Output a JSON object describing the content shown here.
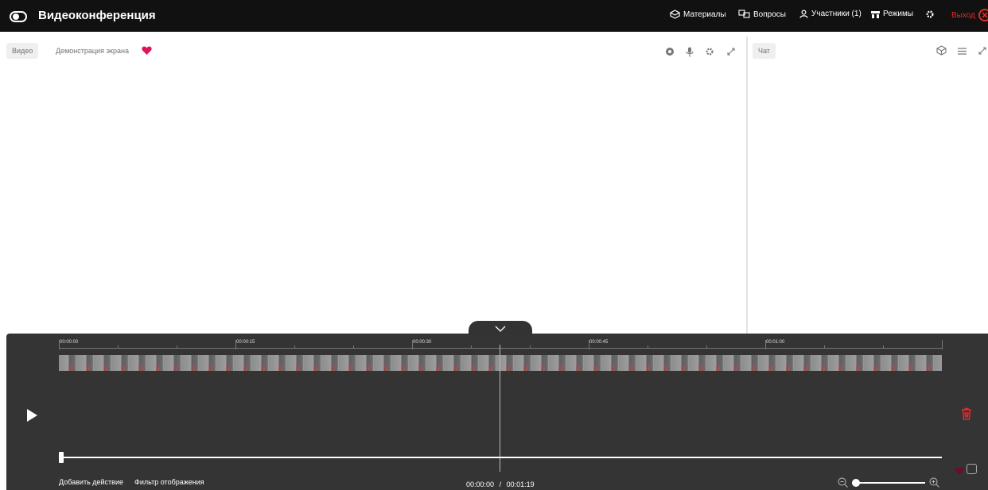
{
  "header": {
    "title": "Видеоконференция",
    "nav": {
      "materials": "Материалы",
      "questions": "Вопросы",
      "participants": "Участники (1)",
      "modes": "Режимы",
      "exit": "Выход"
    }
  },
  "main_panel": {
    "tabs": {
      "video": "Видео",
      "screen_share": "Демонстрация экрана"
    }
  },
  "right_panel": {
    "tabs": {
      "chat": "Чат"
    }
  },
  "timeline": {
    "ruler_labels": [
      "00:00:00",
      "00:00:15",
      "00:00:30",
      "00:00:45",
      "00:01:00"
    ],
    "add_action": "Добавить действие",
    "display_filter": "Фильтр отображения",
    "current_time": "00:00:00",
    "separator": "/",
    "total_time": "00:01:19"
  },
  "colors": {
    "header_bg": "#111111",
    "timeline_bg": "#343434",
    "accent_red": "#e32b2b",
    "heart_pink": "#e0155b"
  },
  "icons": [
    "toggle-icon",
    "cube-icon",
    "questions-icon",
    "user-icon",
    "modes-icon",
    "gear-icon",
    "close-circle-icon",
    "heart-icon",
    "location-icon",
    "microphone-icon",
    "expand-icon",
    "menu-icon",
    "chevron-down-icon",
    "play-icon",
    "trash-icon",
    "zoom-out-icon",
    "zoom-in-icon",
    "chat-icon"
  ]
}
